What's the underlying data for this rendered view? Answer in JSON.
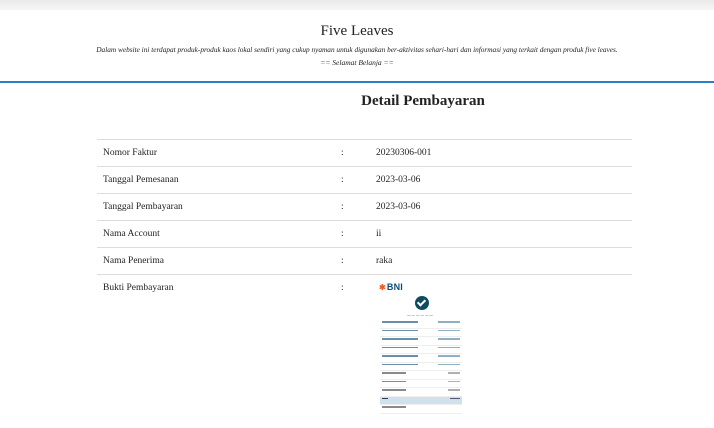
{
  "site": {
    "title": "Five Leaves",
    "tagline": "Dalam website ini terdapat produk-produk kaos lokal sendiri yang cukup nyaman untuk digunakan ber-aktivitas sehari-hari dan informasi yang terkait dengan produk five leaves.",
    "greeting": "== Selamat Belanja =="
  },
  "page": {
    "title": "Detail Pembayaran"
  },
  "details": {
    "separator": ":",
    "rows": [
      {
        "label": "Nomor Faktur",
        "value": "20230306-001"
      },
      {
        "label": "Tanggal Pemesanan",
        "value": "2023-03-06"
      },
      {
        "label": "Tanggal Pembayaran",
        "value": "2023-03-06"
      },
      {
        "label": "Nama Account",
        "value": "ii"
      },
      {
        "label": "Nama Penerima",
        "value": "raka"
      },
      {
        "label": "Bukti Pembayaran",
        "value": ""
      }
    ]
  },
  "receipt": {
    "bank_logo": "BNI",
    "status_icon": "check-circle-icon",
    "colors": {
      "accent": "#2f7fc8",
      "bni_orange": "#f15a22",
      "bni_teal": "#0f4c5f"
    }
  }
}
